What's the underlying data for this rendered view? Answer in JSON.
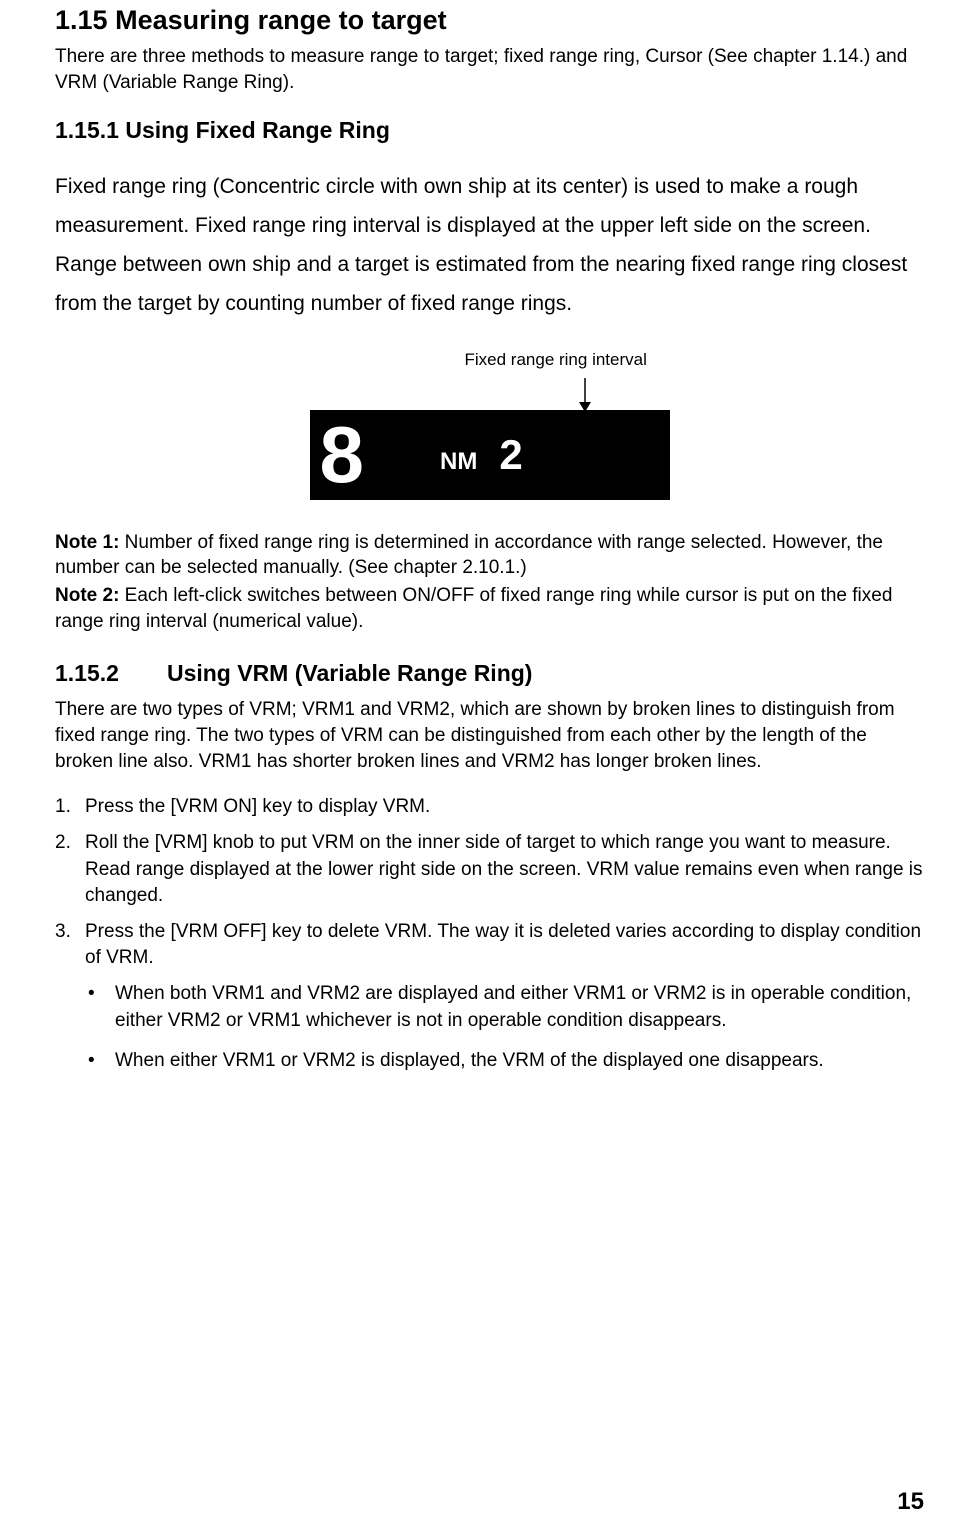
{
  "section": {
    "number": "1.15",
    "title": "Measuring range to target",
    "intro": "There are three methods to measure range to target; fixed range ring, Cursor (See chapter 1.14.) and VRM (Variable Range Ring)."
  },
  "sub1": {
    "number": "1.15.1",
    "title": "Using Fixed Range Ring",
    "body": "Fixed range ring (Concentric circle with own ship at its center) is used to make a rough measurement. Fixed range ring interval is displayed at the upper left side on the screen. Range between own ship and a target is estimated from the nearing fixed range ring closest from the target by counting number of fixed range rings."
  },
  "figure": {
    "label": "Fixed range ring interval",
    "display_main": "8",
    "display_unit": "NM",
    "display_sub": "2"
  },
  "notes": {
    "n1_label": "Note 1:",
    "n1_body": " Number of fixed range ring is determined in accordance with range selected. However, the number can be selected manually. (See  chapter 2.10.1.)",
    "n2_label": "Note 2:",
    "n2_body": " Each left-click switches between ON/OFF of fixed range ring while cursor is put on the fixed range ring interval (numerical value)."
  },
  "sub2": {
    "number": "1.15.2",
    "title": "Using VRM (Variable Range Ring)",
    "intro": "There are two types of VRM; VRM1 and VRM2, which are shown by broken lines to distinguish from fixed range ring. The two types of VRM can be distinguished from each other by the length of the broken line also. VRM1 has shorter broken lines and VRM2 has longer broken lines.",
    "steps": [
      "Press the [VRM ON] key to display VRM.",
      "Roll the [VRM] knob to put VRM on the inner side of target to which range you want to measure. Read range displayed at the lower right side on the screen. VRM value remains even when range is changed.",
      "Press the [VRM OFF] key to delete VRM. The way it is deleted varies according to display condition of VRM."
    ],
    "bullets": [
      "When both VRM1 and VRM2 are displayed and either VRM1 or VRM2 is in operable condition, either VRM2 or VRM1 whichever is not in operable condition disappears.",
      "When either VRM1 or VRM2 is displayed, the VRM of the displayed one disappears."
    ]
  },
  "page_number": "15"
}
